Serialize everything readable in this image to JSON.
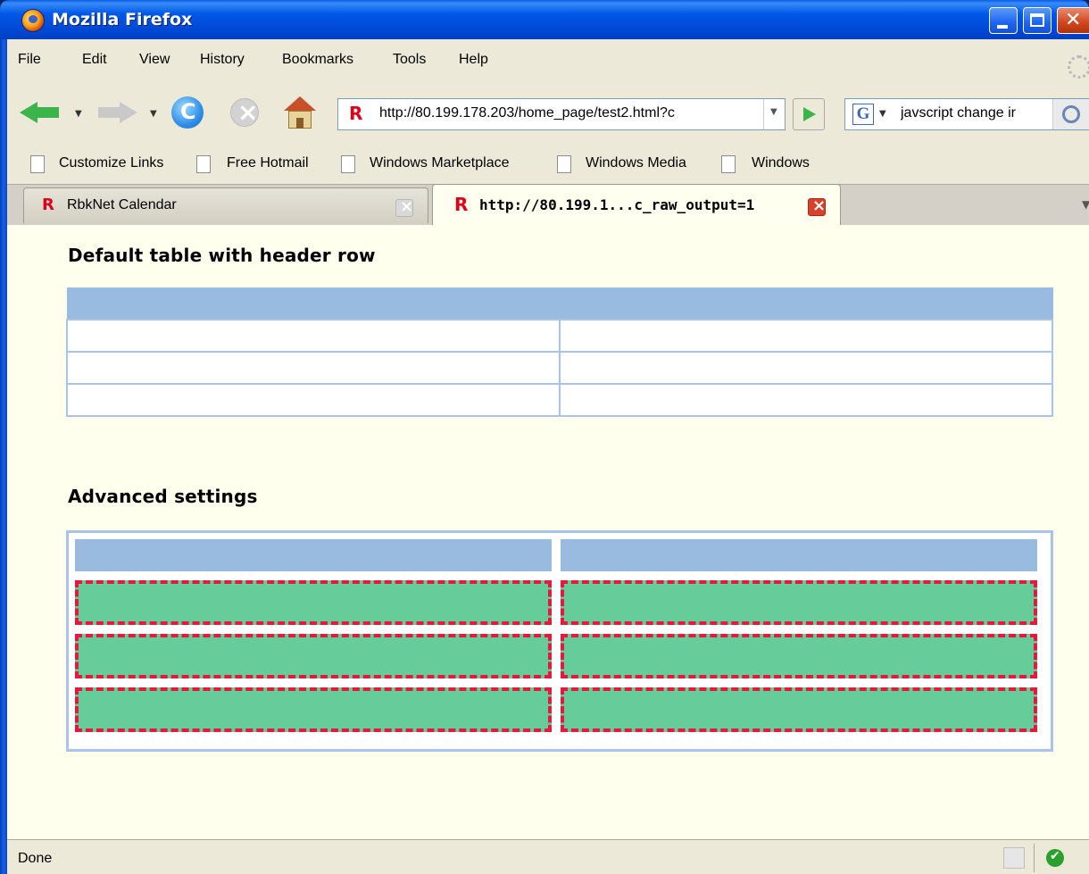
{
  "window": {
    "title": "Mozilla Firefox"
  },
  "menu": [
    "File",
    "Edit",
    "View",
    "History",
    "Bookmarks",
    "Tools",
    "Help"
  ],
  "navigation": {
    "url": "http://80.199.178.203/home_page/test2.html?c",
    "search_value": "javscript change ir",
    "search_engine_icon": "G"
  },
  "bookmarks": [
    "Customize Links",
    "Free Hotmail",
    "Windows Marketplace",
    "Windows Media",
    "Windows"
  ],
  "tabs": [
    {
      "label": "RbkNet Calendar",
      "icon": "R"
    },
    {
      "label": "http://80.199.1...c_raw_output=1",
      "icon": "R"
    }
  ],
  "content": {
    "section1_title": "Default table with header row",
    "section2_title": "Advanced settings"
  },
  "status": {
    "text": "Done"
  },
  "colors": {
    "header_row": "#99bbe0",
    "table_border": "#a9c4e6",
    "cell_fill": "#66cc99",
    "cell_dashed_border": "#e8173c",
    "page_background": "#ffffee"
  }
}
